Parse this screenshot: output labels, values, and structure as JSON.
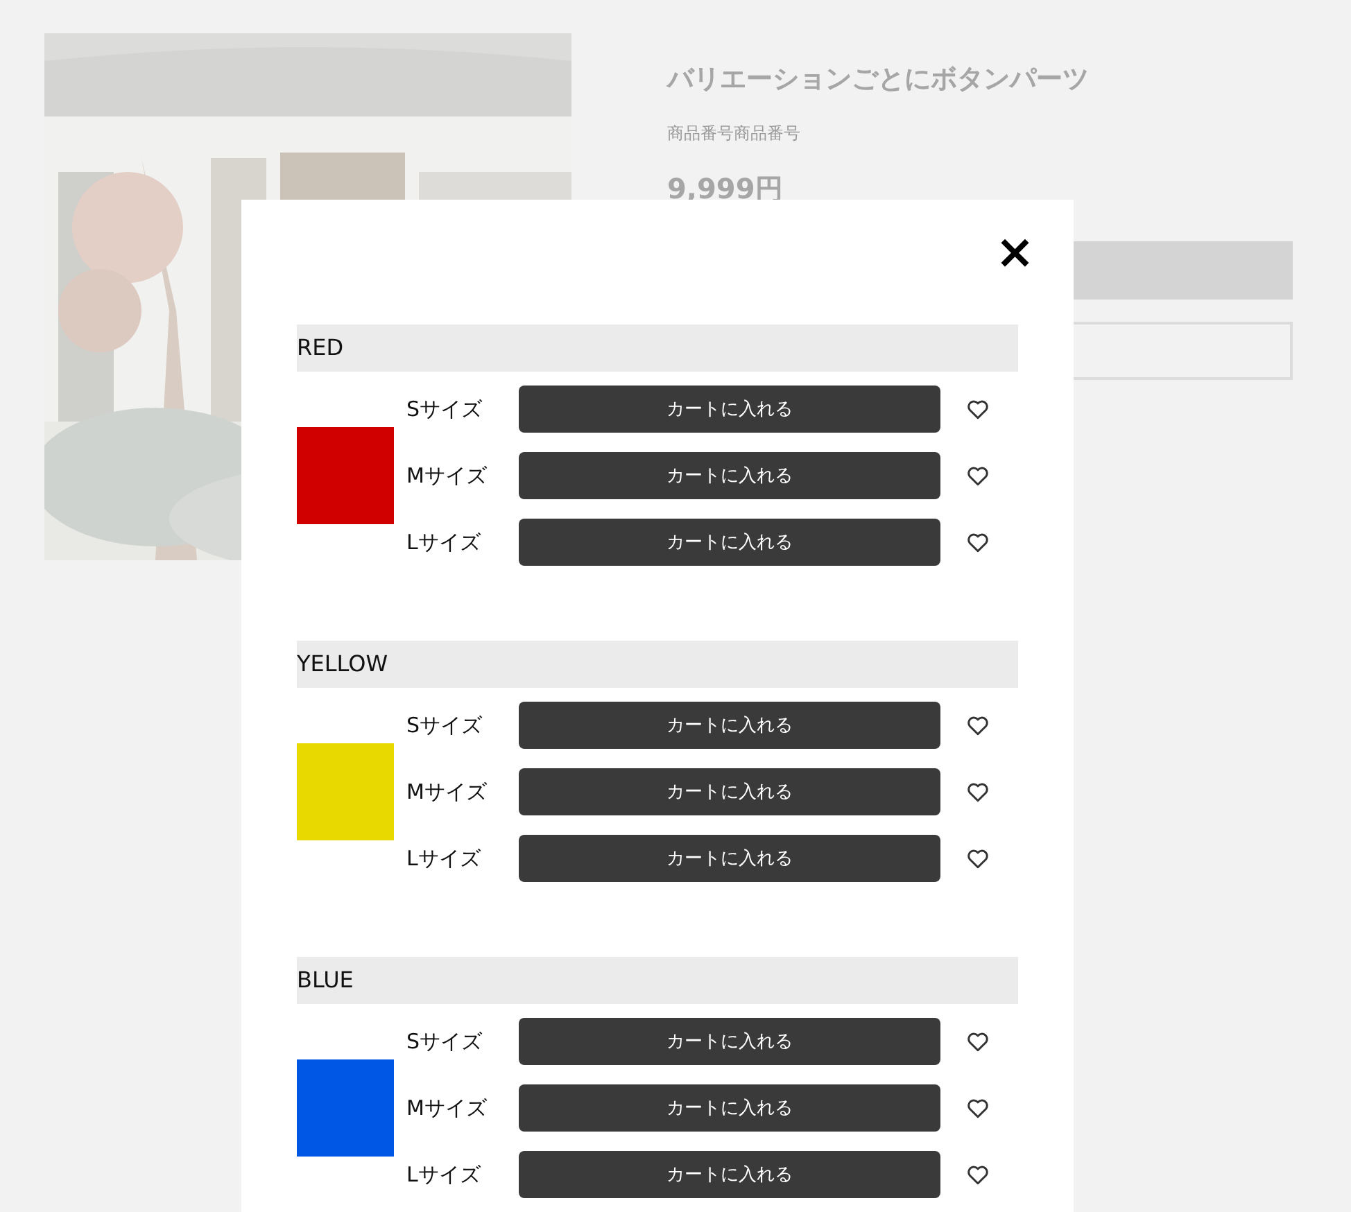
{
  "product": {
    "title": "バリエーションごとにボタンパーツ",
    "product_number": "商品番号商品番号",
    "price": "9,999円"
  },
  "modal": {
    "close": "×",
    "variations": [
      {
        "name": "RED",
        "color": "#d10000",
        "sizes": [
          {
            "label": "Sサイズ",
            "button": "カートに入れる"
          },
          {
            "label": "Mサイズ",
            "button": "カートに入れる"
          },
          {
            "label": "Lサイズ",
            "button": "カートに入れる"
          }
        ]
      },
      {
        "name": "YELLOW",
        "color": "#e8d900",
        "sizes": [
          {
            "label": "Sサイズ",
            "button": "カートに入れる"
          },
          {
            "label": "Mサイズ",
            "button": "カートに入れる"
          },
          {
            "label": "Lサイズ",
            "button": "カートに入れる"
          }
        ]
      },
      {
        "name": "BLUE",
        "color": "#0057e6",
        "sizes": [
          {
            "label": "Sサイズ",
            "button": "カートに入れる"
          },
          {
            "label": "Mサイズ",
            "button": "カートに入れる"
          },
          {
            "label": "Lサイズ",
            "button": "カートに入れる"
          }
        ]
      }
    ]
  }
}
